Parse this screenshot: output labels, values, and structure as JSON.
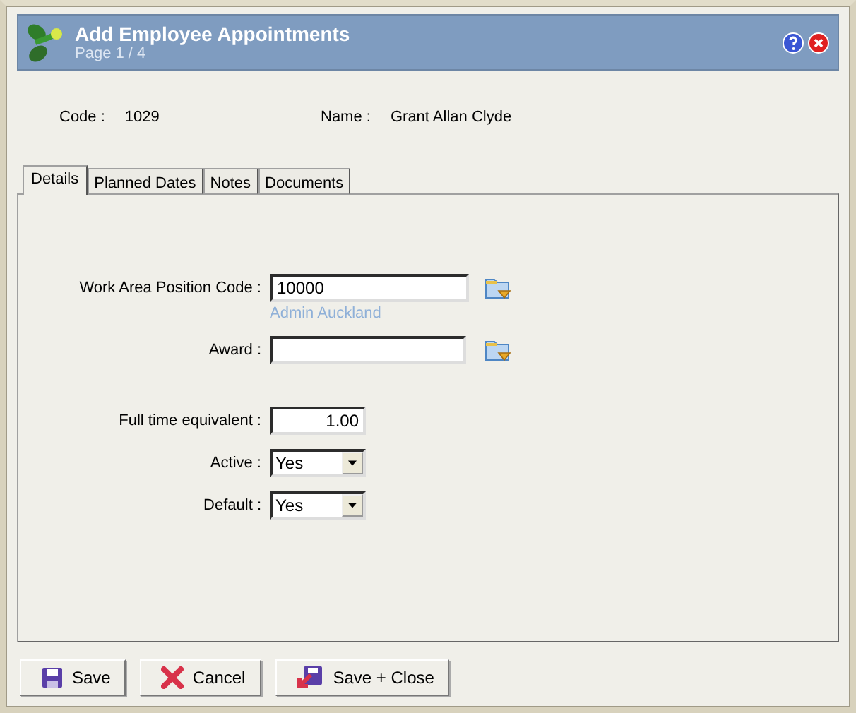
{
  "window": {
    "title": "Add Employee Appointments",
    "subtitle": "Page 1 / 4"
  },
  "header_fields": [
    {
      "label": "Code :",
      "value": "1029"
    },
    {
      "label": "Name :",
      "value": "Grant Allan Clyde"
    }
  ],
  "tabs": [
    {
      "label": "Details",
      "selected": true
    },
    {
      "label": "Planned Dates",
      "selected": false
    },
    {
      "label": "Notes",
      "selected": false
    },
    {
      "label": "Documents",
      "selected": false
    }
  ],
  "fields": [
    {
      "kind": "lookup",
      "label": "Work Area Position Code :",
      "value": "10000",
      "hint": "Admin Auckland"
    },
    {
      "kind": "lookup",
      "label": "Award :"
    },
    {
      "kind": "number",
      "label": "Full time equivalent :",
      "value": "1.00"
    },
    {
      "kind": "select",
      "label": "Active :",
      "value": "Yes"
    },
    {
      "kind": "select",
      "label": "Default :",
      "value": "Yes"
    }
  ],
  "buttons": [
    {
      "kind": "save",
      "label": "Save"
    },
    {
      "kind": "cancel",
      "label": "Cancel"
    },
    {
      "kind": "save_close",
      "label": "Save + Close"
    }
  ]
}
